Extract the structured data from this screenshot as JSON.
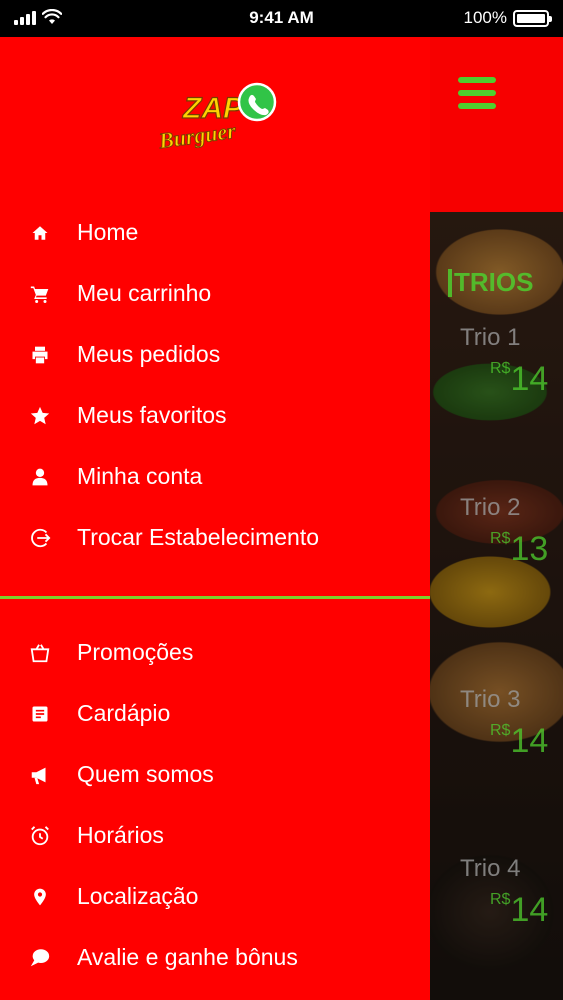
{
  "status_bar": {
    "time": "9:41 AM",
    "battery": "100%"
  },
  "logo": {
    "line1": "ZAP",
    "line2": "Burguer"
  },
  "menu_primary": [
    {
      "label": "Home",
      "icon": "home-icon"
    },
    {
      "label": "Meu carrinho",
      "icon": "cart-icon"
    },
    {
      "label": "Meus pedidos",
      "icon": "printer-icon"
    },
    {
      "label": "Meus favoritos",
      "icon": "star-icon"
    },
    {
      "label": "Minha conta",
      "icon": "person-icon"
    },
    {
      "label": "Trocar Estabelecimento",
      "icon": "exit-icon"
    }
  ],
  "menu_secondary": [
    {
      "label": "Promoções",
      "icon": "shopping-bag-icon"
    },
    {
      "label": "Cardápio",
      "icon": "document-icon"
    },
    {
      "label": "Quem somos",
      "icon": "megaphone-icon"
    },
    {
      "label": "Horários",
      "icon": "alarm-clock-icon"
    },
    {
      "label": "Localização",
      "icon": "location-pin-icon"
    },
    {
      "label": "Avalie e ganhe bônus",
      "icon": "chat-bubble-icon"
    }
  ],
  "background": {
    "section_title": "TRIOS",
    "items": [
      {
        "name": "Trio 1",
        "currency": "R$",
        "price": "14"
      },
      {
        "name": "Trio 2",
        "currency": "R$",
        "price": "13"
      },
      {
        "name": "Trio 3",
        "currency": "R$",
        "price": "14"
      },
      {
        "name": "Trio 4",
        "currency": "R$",
        "price": "14"
      }
    ]
  },
  "colors": {
    "drawer": "#ff0000",
    "accent_green": "#4fce2e",
    "divider": "#7cd12b"
  }
}
